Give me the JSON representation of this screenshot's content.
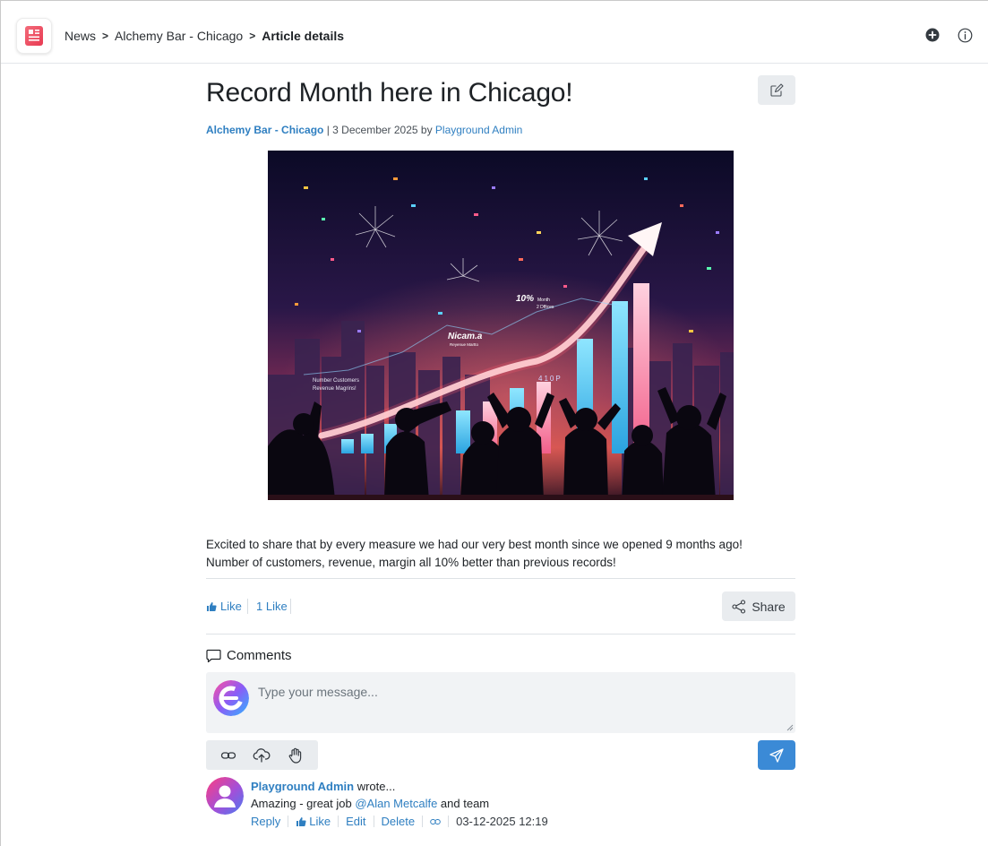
{
  "header": {
    "app_icon": "news-app-icon",
    "breadcrumb": [
      "News",
      "Alchemy Bar - Chicago",
      "Article details"
    ],
    "separator": ">",
    "actions": [
      "add-circle-icon",
      "info-icon"
    ]
  },
  "article": {
    "title": "Record Month here in Chicago!",
    "location": "Alchemy Bar - Chicago",
    "meta_sep": " | ",
    "date": "3 December 2025",
    "by": " by ",
    "author": "Playground Admin",
    "image_labels": {
      "percent": "10%",
      "percent_sub": "Month",
      "percent_sub2": "2 Dffices",
      "brand": "Nicam.a",
      "brand_sub": "Reyenue Martto",
      "legend1": "Number Customers",
      "legend2": "Revenue Magrins!",
      "mid": "410P"
    },
    "body_line1": "Excited to share that by every measure we had our very best month since we opened 9 months ago!",
    "body_line2": "Number of customers, revenue, margin all 10% better than previous records!"
  },
  "reactions": {
    "like_label": "Like",
    "like_count": "1 Like",
    "share_label": "Share"
  },
  "comments": {
    "heading": "Comments",
    "placeholder": "Type your message...",
    "tools": [
      "link-icon",
      "upload-cloud-icon",
      "hand-icon"
    ],
    "items": [
      {
        "author": "Playground Admin",
        "wrote": " wrote...",
        "text_before": "Amazing - great job ",
        "mention": "@Alan Metcalfe",
        "text_after": " and team",
        "reply": "Reply",
        "like": "Like",
        "edit": "Edit",
        "delete": "Delete",
        "timestamp": "03-12-2025 12:19"
      }
    ]
  },
  "colors": {
    "link": "#2f7fc1",
    "send_button": "#3b8ad6",
    "button_bg": "#e9ecef"
  }
}
